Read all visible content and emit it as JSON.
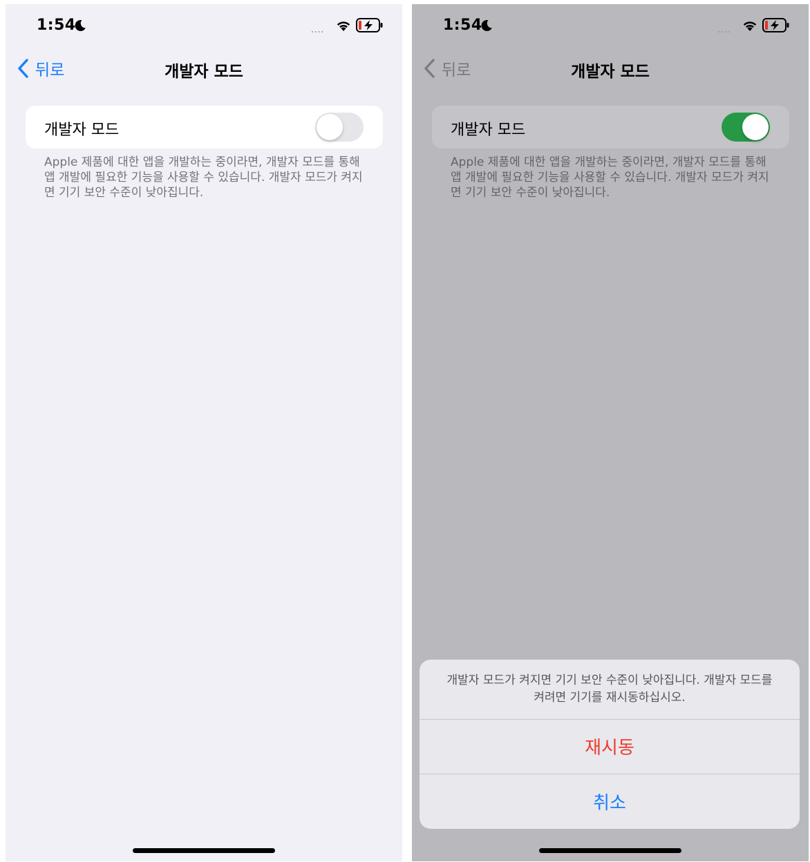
{
  "status_bar": {
    "time": "1:54",
    "moon_icon": "moon-icon",
    "signal": "....",
    "wifi_icon": "wifi-icon",
    "battery_icon": "battery-charging-icon",
    "battery_low_color": "#e5332a"
  },
  "nav": {
    "back_label": "뒤로",
    "title": "개발자 모드"
  },
  "setting": {
    "label": "개발자 모드",
    "footer": "Apple 제품에 대한 앱을 개발하는 중이라면, 개발자 모드를 통해 앱 개발에 필요한 기능을 사용할 수 있습니다. 개발자 모드가 켜지면 기기 보안 수준이 낮아집니다."
  },
  "screens": {
    "left": {
      "toggle_on": false
    },
    "right": {
      "toggle_on": true,
      "toggle_on_color": "#279846"
    }
  },
  "action_sheet": {
    "message": "개발자 모드가 켜지면 기기 보안 수준이 낮아집니다. 개발자 모드를 켜려면 기기를 재시동하십시오.",
    "restart_label": "재시동",
    "cancel_label": "취소",
    "restart_color": "#ee3b2f",
    "cancel_color": "#1a7cff"
  },
  "colors": {
    "accent": "#1a7cff",
    "background_light": "#f0f0f6",
    "background_dimmed": "#b8b8bd"
  }
}
